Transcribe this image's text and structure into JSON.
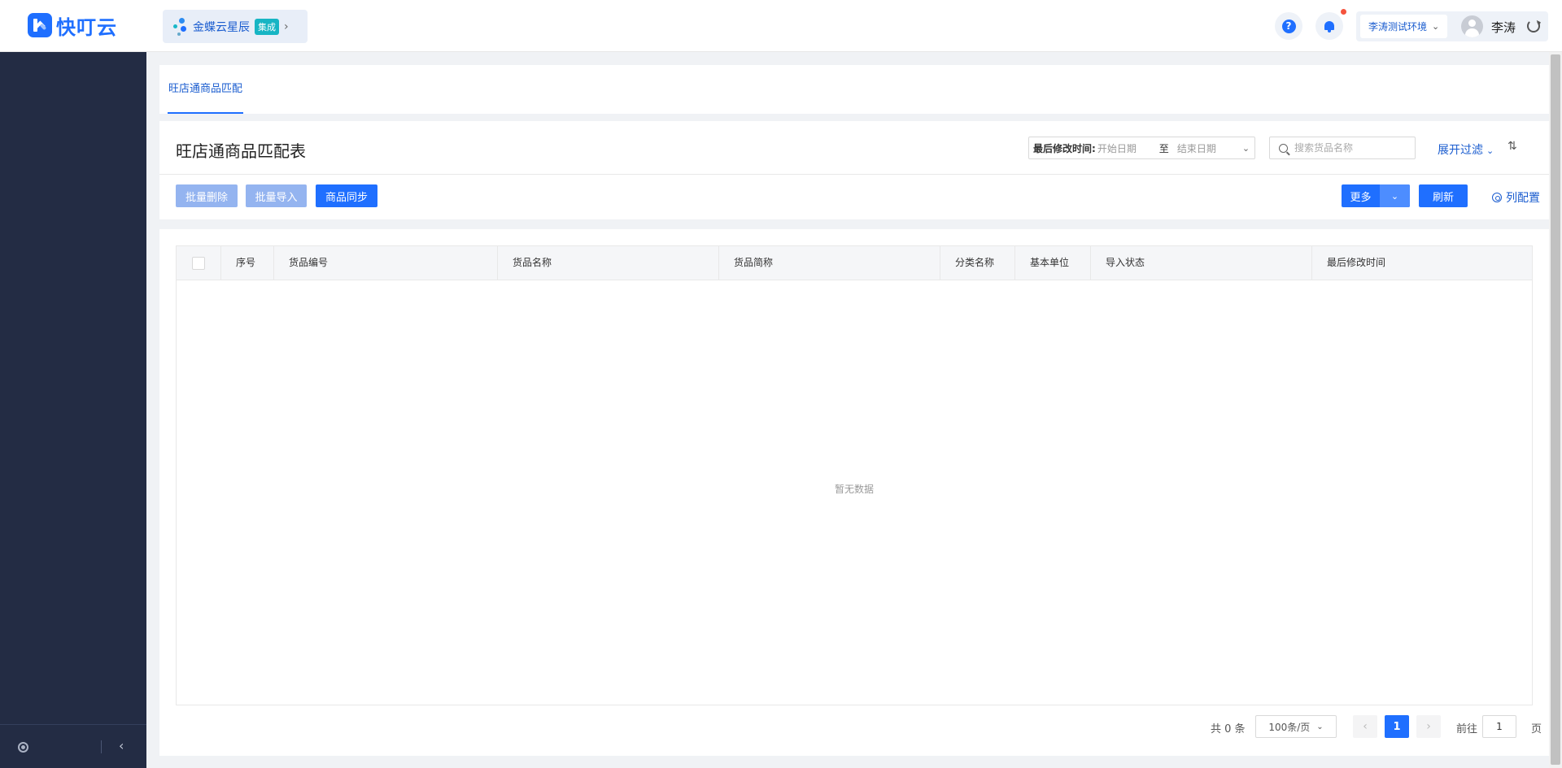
{
  "header": {
    "logo_text": "快叮云",
    "app": {
      "name": "金蝶云星辰",
      "badge": "集成",
      "chevron": "›"
    },
    "help_glyph": "?",
    "environment": {
      "label": "李涛测试环境",
      "chevron": "⌄"
    },
    "user_name": "李涛"
  },
  "sidebar": {
    "collapse_glyph": "‹"
  },
  "tabs": [
    {
      "label": "旺店通商品匹配",
      "active": true
    }
  ],
  "page": {
    "title": "旺店通商品匹配表",
    "date_filter": {
      "label": "最后修改时间:",
      "start_placeholder": "开始日期",
      "separator": "至",
      "end_placeholder": "结束日期",
      "chevron": "⌄"
    },
    "search": {
      "placeholder": "搜索货品名称"
    },
    "expand_filter": {
      "label": "展开过滤",
      "chevron": "⌄"
    },
    "sort_glyph": "⇅"
  },
  "toolbar": {
    "batch_delete": "批量删除",
    "batch_import": "批量导入",
    "sync_goods": "商品同步",
    "more": "更多",
    "more_chevron": "⌄",
    "refresh": "刷新",
    "column_config": "列配置"
  },
  "table": {
    "columns": [
      "序号",
      "货品编号",
      "货品名称",
      "货品简称",
      "分类名称",
      "基本单位",
      "导入状态",
      "最后修改时间"
    ],
    "rows": [],
    "empty_text": "暂无数据"
  },
  "pagination": {
    "total_text": "共 0 条",
    "page_size": "100条/页",
    "size_chevron": "⌄",
    "prev": "‹",
    "current_page": "1",
    "next": "›",
    "goto_label": "前往",
    "goto_value": "1",
    "page_unit": "页"
  },
  "colors": {
    "primary": "#1f6fff",
    "sidebar": "#232c44",
    "disabled_button": "#94b4f0"
  }
}
